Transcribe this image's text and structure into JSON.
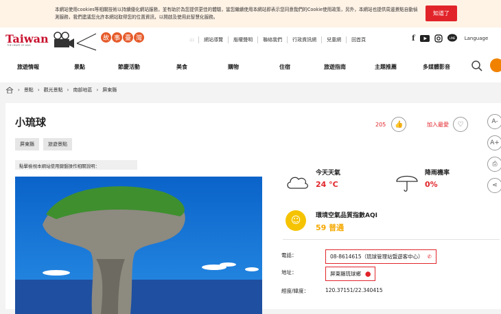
{
  "cookie": {
    "text": "本網站使用cookies等相關技術以持續優化網站服務，並有助於為您提供更佳的體驗，當您繼續使用本網站即表示您同意我們的Cookie使用政策，另外，本網站也提供周邊景點自動偵測服務，我們建議您允許本網站取得您的位置資訊，以開啟及使用此智慧化服務。",
    "button": "知道了"
  },
  "logo": {
    "text": "Taiwan",
    "sub": "THE HEART OF ASIA",
    "bubbles": [
      "故",
      "事",
      "臺",
      "灣"
    ]
  },
  "toplinks": [
    "網站導覽",
    "版權聲明",
    "聯絡我們",
    "行政資訊網",
    "兒童網",
    "回首頁"
  ],
  "lang": "Language",
  "nav": [
    "旅遊情報",
    "景點",
    "節慶活動",
    "美食",
    "購物",
    "住宿",
    "旅遊指南",
    "主題推薦",
    "多媒體影音"
  ],
  "breadcrumb": [
    "景點",
    "觀光景點",
    "南部地區",
    "屏東縣"
  ],
  "title": "小琉球",
  "tags": [
    "屏東縣",
    "旅遊景點"
  ],
  "note": "點擊檢視本網站使用鍵盤操作相關說明：",
  "likes": {
    "count": "205",
    "fav_label": "加入最愛"
  },
  "side_buttons": [
    "A-",
    "A+"
  ],
  "weather": {
    "today_label": "今天天氣",
    "today_value": "24 °C",
    "rain_label": "降雨機率",
    "rain_value": "0%"
  },
  "aqi": {
    "label": "環境空氣品質指數AQI",
    "value": "59 普通"
  },
  "info": {
    "phone_key": "電話：",
    "phone_val": "08-8614615（琉球管理站暨遊客中心）",
    "addr_key": "地址：",
    "addr_val": "屏東縣琉球鄉",
    "coord_key": "經度/緯度：",
    "coord_val": "120.37151/22.340415"
  },
  "colors": {
    "accent": "#e1242a",
    "brand_orange": "#f08200",
    "aqi_yellow": "#f5c300"
  }
}
